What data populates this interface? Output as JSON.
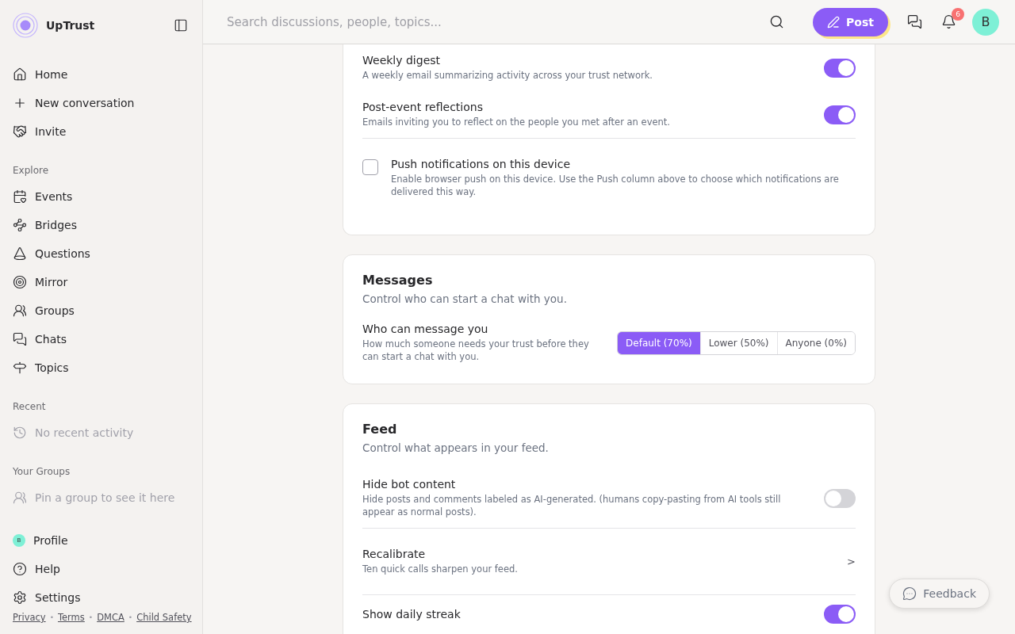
{
  "brand": "UpTrust",
  "nav": [
    {
      "label": "Home"
    },
    {
      "label": "New conversation"
    },
    {
      "label": "Invite"
    }
  ],
  "sections": [
    {
      "title": "Explore",
      "items": [
        {
          "label": "Events",
          "muted": false
        },
        {
          "label": "Bridges",
          "muted": false
        },
        {
          "label": "Questions",
          "muted": false
        },
        {
          "label": "Mirror",
          "muted": false
        },
        {
          "label": "Groups",
          "muted": false
        },
        {
          "label": "Chats",
          "muted": false
        },
        {
          "label": "Topics",
          "muted": false
        }
      ]
    },
    {
      "title": "Recent",
      "items": [
        {
          "label": "No recent activity",
          "muted": true
        }
      ]
    },
    {
      "title": "Your Groups",
      "items": [
        {
          "label": "Pin a group to see it here",
          "muted": true
        }
      ]
    }
  ],
  "bottom_nav": [
    {
      "label": "Profile",
      "avatar": "B"
    },
    {
      "label": "Help"
    },
    {
      "label": "Settings"
    }
  ],
  "footer_links": [
    "Privacy",
    "Terms",
    "DMCA",
    "Child Safety"
  ],
  "footer_separator": "•",
  "search": {
    "placeholder": "Search discussions, people, topics..."
  },
  "post_button": "Post",
  "notification_count": "6",
  "user_avatar": "B",
  "cards": [
    {
      "rows": [
        {
          "kind": "toggle",
          "label": "Weekly digest",
          "description": "A weekly email summarizing activity across your trust network.",
          "on": true
        },
        {
          "kind": "toggle",
          "label": "Post-event reflections",
          "description": "Emails inviting you to reflect on the people you met after an event.",
          "on": true
        },
        {
          "kind": "checkbox",
          "label": "Push notifications on this device",
          "description": "Enable browser push on this device. Use the Push column above to choose which notifications are delivered this way.",
          "checked": false
        }
      ]
    },
    {
      "title": "Messages",
      "subtitle": "Control who can start a chat with you.",
      "rows": [
        {
          "kind": "segmented",
          "label": "Who can message you",
          "description": "How much someone needs your trust before they can start a chat with you.",
          "options": [
            {
              "label": "Default (70%)",
              "selected": true
            },
            {
              "label": "Lower (50%)",
              "selected": false
            },
            {
              "label": "Anyone (0%)",
              "selected": false
            }
          ]
        }
      ]
    },
    {
      "title": "Feed",
      "subtitle": "Control what appears in your feed.",
      "rows": [
        {
          "kind": "toggle",
          "label": "Hide bot content",
          "description": "Hide posts and comments labeled as AI-generated. (humans copy-pasting from AI tools still appear as normal posts).",
          "on": false
        },
        {
          "kind": "link",
          "label": "Recalibrate",
          "description": "Ten quick calls sharpen your feed.",
          "chevron": ">"
        },
        {
          "kind": "toggle",
          "label": "Show daily streak",
          "on": true
        }
      ]
    }
  ],
  "feedback_button": "Feedback"
}
